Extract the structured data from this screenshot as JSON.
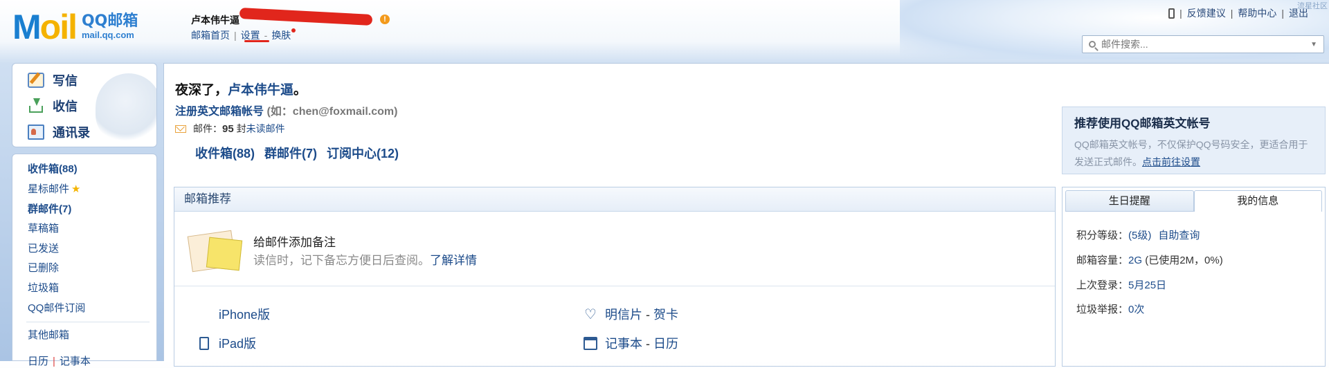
{
  "header": {
    "logo_mark": "M",
    "logo_mark_o": "oil",
    "logo_qq": "QQ邮箱",
    "logo_url": "mail.qq.com",
    "username": "卢本伟牛逼",
    "warn": "!",
    "nav": {
      "home": "邮箱首页",
      "settings": "设置",
      "dash": "-",
      "skin": "换肤",
      "sep": "|"
    },
    "right_links": {
      "feedback": "反馈建议",
      "help": "帮助中心",
      "logout": "退出",
      "sep": "|"
    },
    "corner_tag": "流星社区"
  },
  "search": {
    "placeholder": "邮件搜索..."
  },
  "left": {
    "compose": "写信",
    "receive": "收信",
    "contacts": "通讯录",
    "folders": {
      "inbox": "收件箱(88)",
      "starred": "星标邮件",
      "group": "群邮件(7)",
      "drafts": "草稿箱",
      "sent": "已发送",
      "deleted": "已删除",
      "spam": "垃圾箱",
      "subscriptions": "QQ邮件订阅",
      "other": "其他邮箱",
      "calendar": "日历",
      "cal_sep": "|",
      "notes": "记事本"
    }
  },
  "main": {
    "greeting_prefix": "夜深了，",
    "greeting_name": "卢本伟牛逼",
    "greeting_suffix": "。",
    "register": "注册英文邮箱帐号",
    "register_hint": "(如：chen@foxmail.com)",
    "mail_label": "邮件：",
    "mail_count": "95",
    "mail_unit": "封",
    "unread": "未读邮件",
    "quick": {
      "inbox": "收件箱(88)",
      "group": "群邮件(7)",
      "subscribe": "订阅中心(12)"
    }
  },
  "promo": {
    "title": "推荐使用QQ邮箱英文帐号",
    "text": "QQ邮箱英文帐号，不仅保护QQ号码安全，更适合用于发送正式邮件。",
    "link": "点击前往设置"
  },
  "recommend": {
    "title": "邮箱推荐",
    "note_title": "给邮件添加备注",
    "note_desc": "读信时，记下备忘方便日后查阅。",
    "note_link": "了解详情",
    "iphone": "iPhone版",
    "ipad": "iPad版",
    "postcard": "明信片",
    "card": "贺卡",
    "notebook": "记事本",
    "calendar": "日历",
    "dash": " - "
  },
  "info": {
    "tab_birthday": "生日提醒",
    "tab_myinfo": "我的信息",
    "points_label": "积分等级：",
    "points_value": "(5级)",
    "points_link": "自助查询",
    "capacity_label": "邮箱容量：",
    "capacity_value": "2G",
    "capacity_used": " (已使用2M，0%)",
    "last_login_label": "上次登录：",
    "last_login_value": "5月25日",
    "spam_report_label": "垃圾举报：",
    "spam_report_value": "0次"
  }
}
